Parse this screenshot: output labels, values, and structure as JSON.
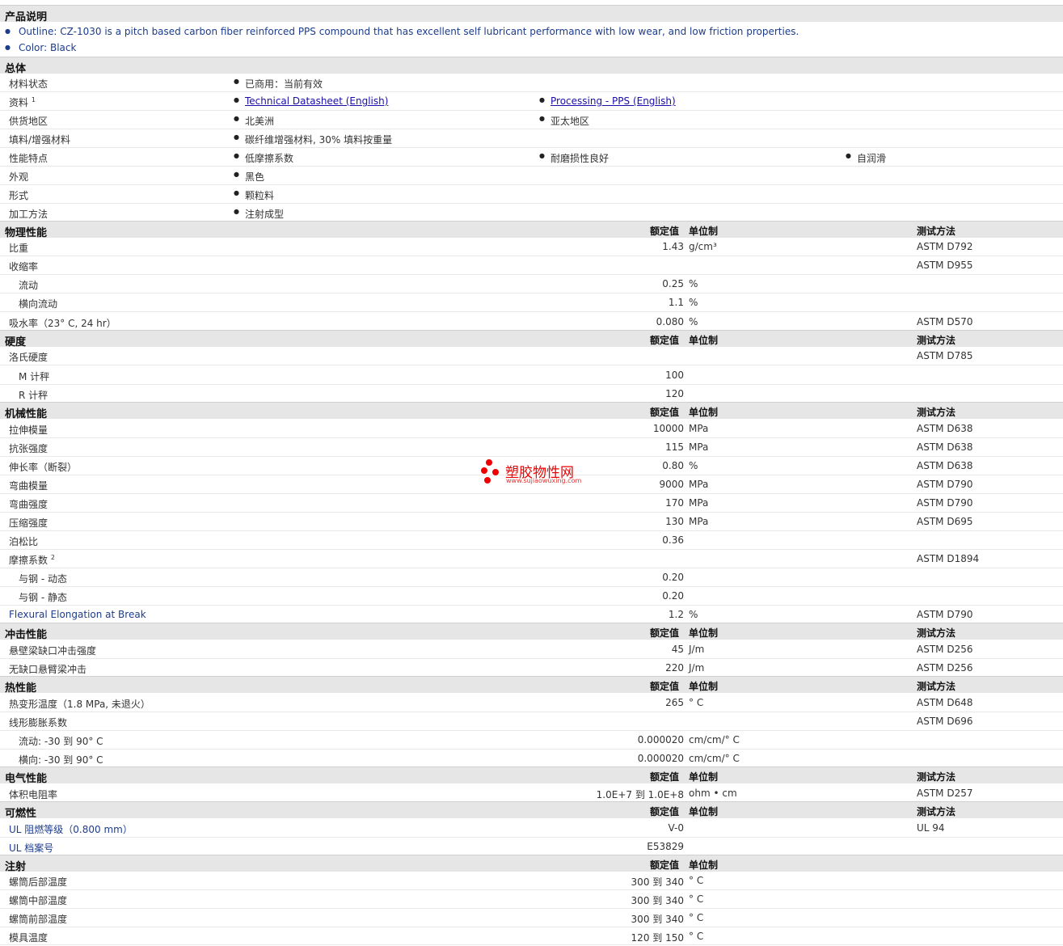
{
  "sections": {
    "desc": "产品说明",
    "general": "总体",
    "physical": "物理性能",
    "hardness": "硬度",
    "mechanical": "机械性能",
    "impact": "冲击性能",
    "thermal": "热性能",
    "electrical": "电气性能",
    "flammability": "可燃性",
    "injection": "注射"
  },
  "headers": {
    "value": "额定值",
    "unit": "单位制",
    "test": "测试方法"
  },
  "description": {
    "outline": "Outline: CZ-1030 is a pitch based carbon fiber reinforced PPS compound that has excellent self lubricant performance with low wear, and low friction properties.",
    "color": "Color: Black"
  },
  "general": {
    "status_label": "材料状态",
    "status": "已商用：当前有效",
    "docs_label": "资料",
    "docs_sup": "1",
    "doc1": "Technical Datasheet (English)",
    "doc2": "Processing - PPS (English)",
    "region_label": "供货地区",
    "region1": "北美洲",
    "region2": "亚太地区",
    "filler_label": "填料/增强材料",
    "filler": "碳纤维增强材料, 30% 填料按重量",
    "features_label": "性能特点",
    "feat1": "低摩擦系数",
    "feat2": "耐磨损性良好",
    "feat3": "自润滑",
    "appearance_label": "外观",
    "appearance": "黑色",
    "form_label": "形式",
    "form": "颗粒料",
    "process_label": "加工方法",
    "process": "注射成型"
  },
  "physical": {
    "sg_label": "比重",
    "sg_val": "1.43",
    "sg_unit": "g/cm³",
    "sg_test": "ASTM D792",
    "shrink_label": "收缩率",
    "shrink_test": "ASTM D955",
    "flow_label": "流动",
    "flow_val": "0.25",
    "flow_unit": "%",
    "tflow_label": "横向流动",
    "tflow_val": "1.1",
    "tflow_unit": "%",
    "wa_label": "吸水率（23°  C, 24 hr）",
    "wa_val": "0.080",
    "wa_unit": "%",
    "wa_test": "ASTM D570"
  },
  "hardness": {
    "rock_label": "洛氏硬度",
    "rock_test": "ASTM D785",
    "m_label": "M 计秤",
    "m_val": "100",
    "r_label": "R 计秤",
    "r_val": "120"
  },
  "mechanical": {
    "tm_label": "拉伸模量",
    "tm_val": "10000",
    "tm_unit": "MPa",
    "tm_test": "ASTM D638",
    "ts_label": "抗张强度",
    "ts_val": "115",
    "ts_unit": "MPa",
    "ts_test": "ASTM D638",
    "el_label": "伸长率（断裂）",
    "el_val": "0.80",
    "el_unit": "%",
    "el_test": "ASTM D638",
    "fm_label": "弯曲模量",
    "fm_val": "9000",
    "fm_unit": "MPa",
    "fm_test": "ASTM D790",
    "fs_label": "弯曲强度",
    "fs_val": "170",
    "fs_unit": "MPa",
    "fs_test": "ASTM D790",
    "cs_label": "压缩强度",
    "cs_val": "130",
    "cs_unit": "MPa",
    "cs_test": "ASTM D695",
    "pr_label": "泊松比",
    "pr_val": "0.36",
    "cof_label": "摩擦系数",
    "cof_sup": "2",
    "cof_test": "ASTM D1894",
    "dyn_label": "与钢 - 动态",
    "dyn_val": "0.20",
    "sta_label": "与钢 - 静态",
    "sta_val": "0.20",
    "feb_label": "Flexural Elongation at Break",
    "feb_val": "1.2",
    "feb_unit": "%",
    "feb_test": "ASTM D790"
  },
  "impact": {
    "notched_label": "悬壁梁缺口冲击强度",
    "notched_val": "45",
    "notched_unit": "J/m",
    "notched_test": "ASTM D256",
    "unnotched_label": "无缺口悬臂梁冲击",
    "unnotched_val": "220",
    "unnotched_unit": "J/m",
    "unnotched_test": "ASTM D256"
  },
  "thermal": {
    "hdt_label": "热变形温度（1.8 MPa, 未退火）",
    "hdt_val": "265",
    "hdt_unit": "°  C",
    "hdt_test": "ASTM D648",
    "clte_label": "线形膨胀系数",
    "clte_test": "ASTM D696",
    "cflow_label": "流动: -30 到  90°  C",
    "cflow_val": "0.000020",
    "cflow_unit": "cm/cm/°  C",
    "ctrans_label": "横向: -30 到  90°  C",
    "ctrans_val": "0.000020",
    "ctrans_unit": "cm/cm/°  C"
  },
  "electrical": {
    "vr_label": "体积电阻率",
    "vr_val": "1.0E+7 到  1.0E+8",
    "vr_unit": "ohm • cm",
    "vr_test": "ASTM D257"
  },
  "flammability": {
    "ul_label": "UL 阻燃等级（0.800 mm）",
    "ul_val": "V-0",
    "ul_test": "UL 94",
    "file_label": "UL 档案号",
    "file_val": "E53829"
  },
  "injection": {
    "rear_label": "螺筒后部温度",
    "rear_val": "300 到  340",
    "rear_unit": "°  C",
    "mid_label": "螺筒中部温度",
    "mid_val": "300 到  340",
    "mid_unit": "°  C",
    "front_label": "螺筒前部温度",
    "front_val": "300 到  340",
    "front_unit": "°  C",
    "mold_label": "模具温度",
    "mold_val": "120 到  150",
    "mold_unit": "°  C"
  },
  "watermark": {
    "cn": "塑胶物性网",
    "url": "www.sujiaowuxing.com"
  }
}
